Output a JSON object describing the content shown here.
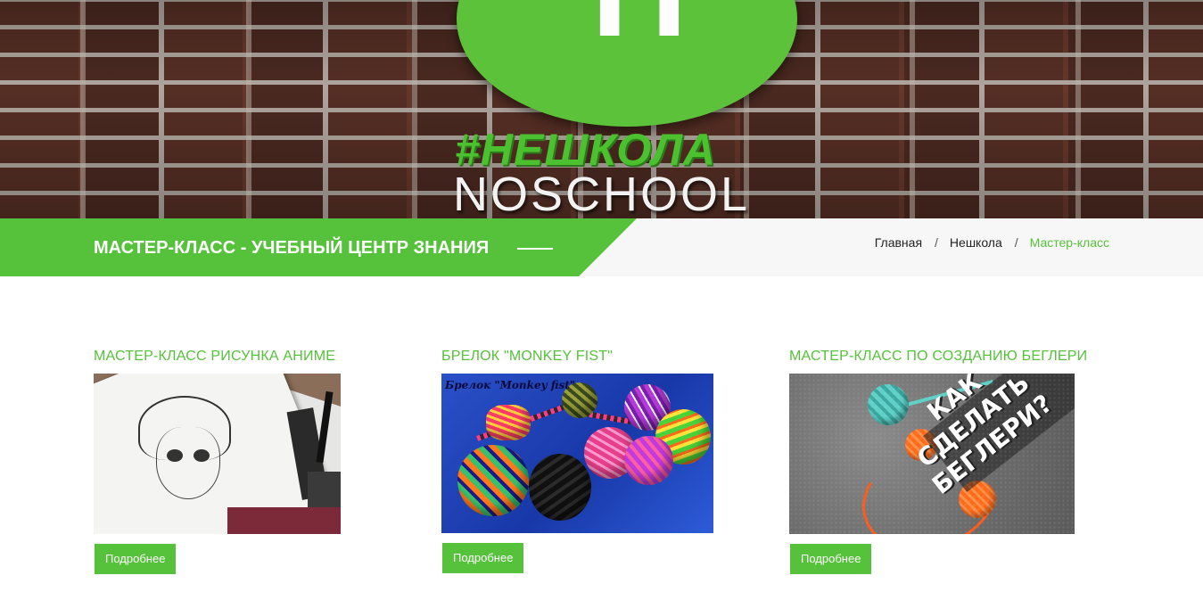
{
  "hero": {
    "logo_letter": "Н",
    "tagline": "#НЕШКОЛА",
    "brand": "NOSCHOOL"
  },
  "header": {
    "title": "МАСТЕР-КЛАСС - УЧЕБНЫЙ ЦЕНТР ЗНАНИЯ"
  },
  "breadcrumb": {
    "items": [
      {
        "label": "Главная"
      },
      {
        "label": "Нешкола"
      },
      {
        "label": "Мастер-класс"
      }
    ],
    "separator": "/"
  },
  "cards": [
    {
      "title": "МАСТЕР-КЛАСС РИСУНКА АНИМЕ",
      "button": "Подробнее"
    },
    {
      "title": "БРЕЛОК \"MONKEY FIST\"",
      "image_label": "Брелок \"Monkey fist\"",
      "button": "Подробнее"
    },
    {
      "title": "МАСТЕР-КЛАСС ПО СОЗДАНИЮ БЕГЛЕРИ",
      "image_caption": "КАК\nСДЕЛАТЬ\nБЕГЛЕРИ?",
      "button": "Подробнее"
    }
  ],
  "colors": {
    "accent": "#56c13b",
    "titlebar_bg": "#f7f7f7",
    "text_dark": "#222222"
  }
}
